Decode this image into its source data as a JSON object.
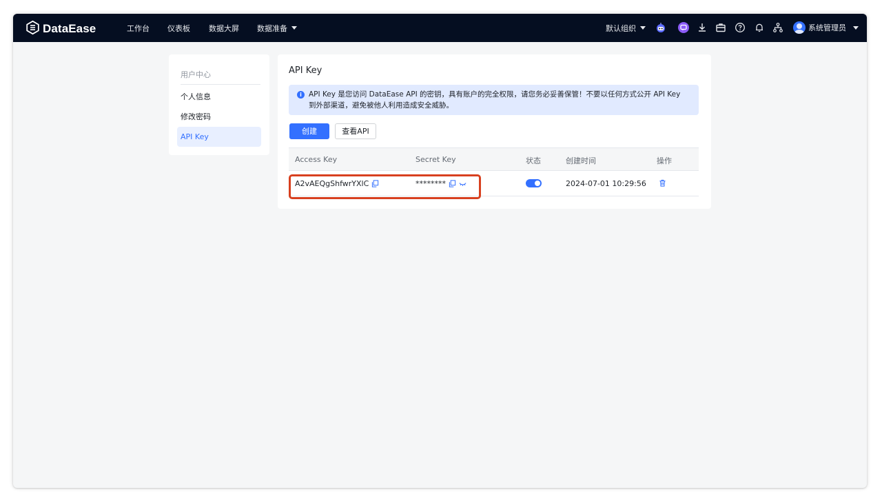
{
  "app": {
    "logo_text": "DataEase"
  },
  "nav": {
    "items": [
      "工作台",
      "仪表板",
      "数据大屏",
      "数据准备"
    ],
    "org_label": "默认组织",
    "user_label": "系统管理员"
  },
  "sidebar": {
    "title": "用户中心",
    "items": [
      {
        "label": "个人信息",
        "active": false
      },
      {
        "label": "修改密码",
        "active": false
      },
      {
        "label": "API Key",
        "active": true
      }
    ]
  },
  "main": {
    "title": "API Key",
    "alert": "API Key 是您访问 DataEase API 的密钥，具有账户的完全权限，请您务必妥善保管！不要以任何方式公开 API Key 到外部渠道，避免被他人利用造成安全威胁。",
    "create_button": "创建",
    "view_api_button": "查看API",
    "table": {
      "columns": [
        "Access Key",
        "Secret Key",
        "状态",
        "创建时间",
        "操作"
      ],
      "rows": [
        {
          "access_key": "A2vAEQgShfwrYXlC",
          "secret_key": "********",
          "status_enabled": true,
          "created_at": "2024-07-01 10:29:56"
        }
      ]
    }
  },
  "colors": {
    "topbar": "#050e21",
    "primary": "#3370ff",
    "alert_bg": "#e1eaff",
    "highlight": "#d8401f"
  },
  "icons": [
    "logo-icon",
    "robot-icon",
    "assistant-icon",
    "download-icon",
    "briefcase-icon",
    "help-icon",
    "bell-icon",
    "org-tree-icon",
    "info-icon",
    "copy-icon",
    "eye-closed-icon",
    "trash-icon"
  ]
}
